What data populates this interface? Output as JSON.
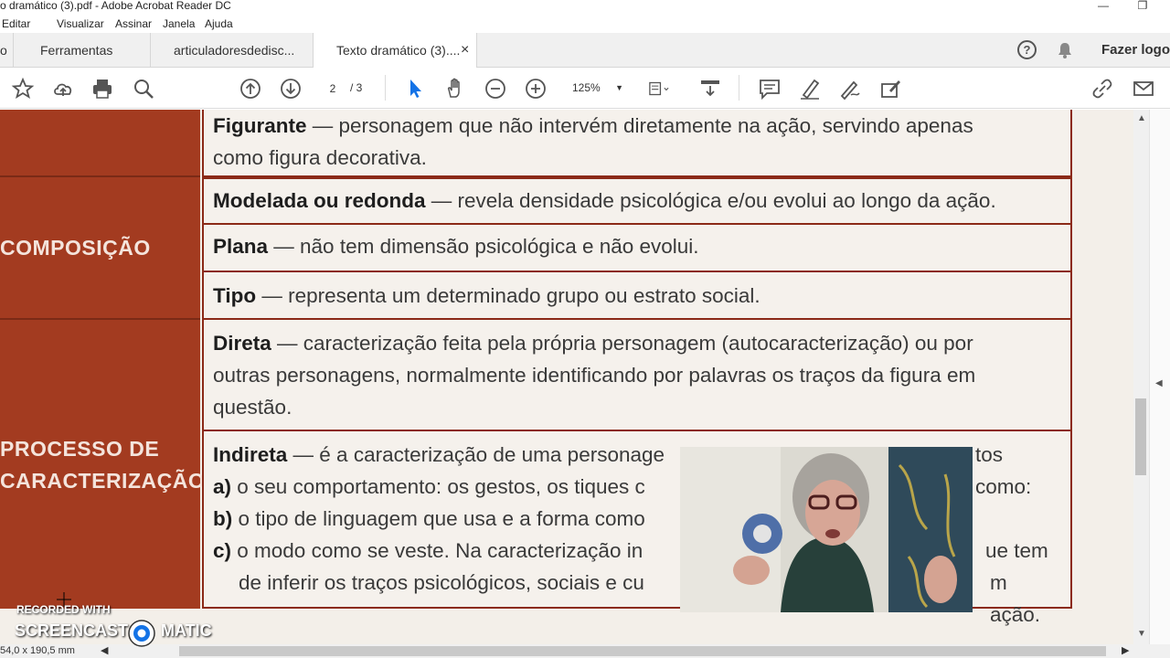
{
  "window": {
    "title": "o dramático (3).pdf - Adobe Acrobat Reader DC",
    "minimize": "—",
    "restore": "❐"
  },
  "menu": {
    "items": [
      "Editar",
      "Visualizar",
      "Assinar",
      "Janela",
      "Ajuda"
    ]
  },
  "tabs": {
    "home_fragment": "o",
    "tools": "Ferramentas",
    "doc1": "articuladoresdedisc...",
    "doc2": "Texto dramático (3)....",
    "close": "×",
    "help": "?",
    "login": "Fazer logo"
  },
  "toolbar": {
    "page_current": "2",
    "page_total": "/ 3",
    "zoom": "125%",
    "zoom_arrow": "▼"
  },
  "document": {
    "left_labels": {
      "composicao": "COMPOSIÇÃO",
      "processo_line1": "PROCESSO DE",
      "processo_line2": "CARACTERIZAÇÃO"
    },
    "rows": [
      {
        "term": "Figurante",
        "text_line1": " — personagem que não intervém diretamente na ação, servindo apenas",
        "text_line2": "como figura decorativa."
      },
      {
        "term": "Modelada ou redonda",
        "text_line1": " — revela densidade psicológica e/ou evolui ao longo da ação."
      },
      {
        "term": "Plana",
        "text_line1": " — não tem dimensão psicológica e não evolui."
      },
      {
        "term": "Tipo",
        "text_line1": " — representa um determinado grupo ou estrato social."
      },
      {
        "term": "Direta",
        "text_line1": " — caracterização feita pela própria personagem (autocaracterização) ou por",
        "text_line2": "outras personagens, normalmente identificando por palavras os traços da figura em",
        "text_line3": "questão."
      },
      {
        "term": "Indireta",
        "text_line1": " — é a caracterização de uma personage",
        "text_line1_end": "tos como:",
        "a_label": "a)",
        "a_text": " o seu comportamento: os gestos, os tiques c",
        "b_label": "b)",
        "b_text": " o tipo de linguagem que usa e a forma como",
        "c_label": "c)",
        "c_text": " o modo como se veste. Na caracterização in",
        "c_end": "ue tem",
        "d_text": "de inferir os traços psicológicos, sociais e cu",
        "d_end": "m ação."
      }
    ]
  },
  "status": {
    "dimensions": "54,0 x 190,5 mm"
  },
  "watermark": {
    "line1": "RECORDED WITH",
    "brand_left": "SCREENCAST",
    "brand_right": "MATIC"
  },
  "colors": {
    "table_red": "#a33b20",
    "border_red": "#8b2a18",
    "accent_blue": "#1473e6"
  }
}
